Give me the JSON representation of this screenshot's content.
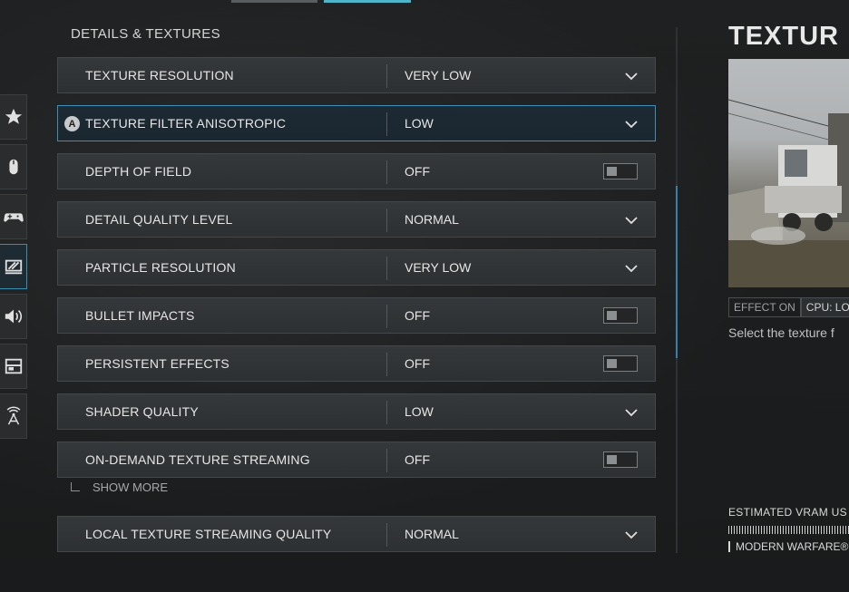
{
  "section": {
    "title": "DETAILS & TEXTURES"
  },
  "sidebar": {
    "items": [
      {
        "icon": "star-icon"
      },
      {
        "icon": "mouse-icon"
      },
      {
        "icon": "controller-icon"
      },
      {
        "icon": "graphics-icon",
        "active": true
      },
      {
        "icon": "speaker-icon"
      },
      {
        "icon": "interface-icon"
      },
      {
        "icon": "network-icon"
      }
    ]
  },
  "settings": [
    {
      "label": "TEXTURE RESOLUTION",
      "value": "VERY LOW",
      "control": "dropdown"
    },
    {
      "label": "TEXTURE FILTER ANISOTROPIC",
      "value": "LOW",
      "control": "dropdown",
      "selected": true,
      "badge": "A"
    },
    {
      "label": "DEPTH OF FIELD",
      "value": "OFF",
      "control": "toggle"
    },
    {
      "label": "DETAIL QUALITY LEVEL",
      "value": "NORMAL",
      "control": "dropdown"
    },
    {
      "label": "PARTICLE RESOLUTION",
      "value": "VERY LOW",
      "control": "dropdown"
    },
    {
      "label": "BULLET IMPACTS",
      "value": "OFF",
      "control": "toggle"
    },
    {
      "label": "PERSISTENT EFFECTS",
      "value": "OFF",
      "control": "toggle"
    },
    {
      "label": "SHADER QUALITY",
      "value": "LOW",
      "control": "dropdown"
    },
    {
      "label": "ON-DEMAND TEXTURE STREAMING",
      "value": "OFF",
      "control": "toggle"
    },
    {
      "label": "LOCAL TEXTURE STREAMING QUALITY",
      "value": "NORMAL",
      "control": "dropdown"
    }
  ],
  "show_more": "SHOW MORE",
  "detail_panel": {
    "title": "TEXTUR",
    "chips": [
      "EFFECT ON",
      "CPU: LO"
    ],
    "description": "Select the texture f",
    "vram_label": "ESTIMATED VRAM US",
    "game_label": "MODERN WARFARE®"
  },
  "colors": {
    "accent": "#3d8fb8",
    "row_bg": "#313436",
    "selected_bg": "#1d2a34"
  }
}
